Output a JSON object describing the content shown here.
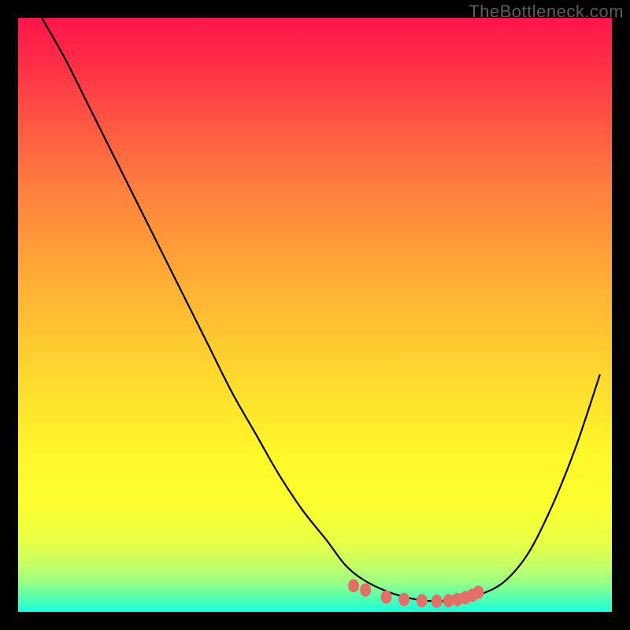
{
  "watermark": "TheBottleneck.com",
  "colors": {
    "background": "#000000",
    "curve_stroke": "#000000",
    "marker_fill": "#e27066",
    "marker_stroke": "#e27066"
  },
  "chart_data": {
    "type": "line",
    "title": "",
    "xlabel": "",
    "ylabel": "",
    "xlim": [
      0,
      100
    ],
    "ylim": [
      0,
      100
    ],
    "grid": false,
    "legend": false,
    "series": [
      {
        "name": "curve",
        "x": [
          4,
          8,
          12,
          16,
          20,
          24,
          28,
          32,
          36,
          40,
          44,
          48,
          52,
          55,
          58,
          62,
          66,
          70,
          74,
          78,
          82,
          86,
          90,
          94,
          98
        ],
        "y": [
          100,
          93,
          85,
          77,
          69,
          61,
          53,
          45,
          37,
          30,
          23,
          17,
          12,
          8,
          5.5,
          3.5,
          2.3,
          1.8,
          2.1,
          3.0,
          5.2,
          10,
          18,
          28,
          40
        ]
      }
    ],
    "markers": {
      "name": "bottom-band",
      "x": [
        56.5,
        58.5,
        62,
        65,
        68,
        70.5,
        72.5,
        74,
        75.3,
        76.5,
        77.5
      ],
      "y": [
        4.4,
        3.7,
        2.5,
        2.1,
        1.9,
        1.8,
        1.9,
        2.1,
        2.4,
        2.8,
        3.3
      ]
    }
  }
}
